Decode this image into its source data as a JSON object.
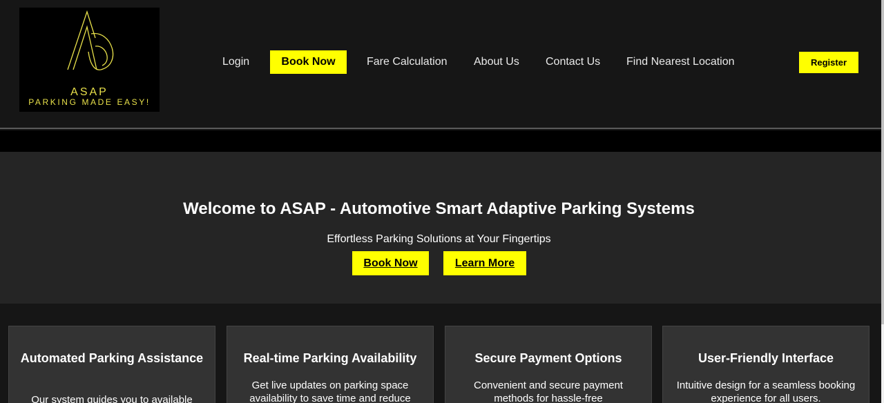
{
  "brand": {
    "name": "ASAP",
    "tagline": "PARKING MADE EASY!",
    "accent_color": "#e8e04a"
  },
  "nav": {
    "login": "Login",
    "book_now": "Book Now",
    "fare_calculation": "Fare Calculation",
    "about_us": "About Us",
    "contact_us": "Contact Us",
    "find_nearest": "Find Nearest Location",
    "register": "Register"
  },
  "hero": {
    "title": "Welcome to ASAP - Automotive Smart Adaptive Parking Systems",
    "subtitle": "Effortless Parking Solutions at Your Fingertips",
    "book_now": "Book Now",
    "learn_more": "Learn More"
  },
  "features": [
    {
      "title": "Automated Parking Assistance",
      "text": "Our system guides you to available"
    },
    {
      "title": "Real-time Parking Availability",
      "text": "Get live updates on parking space availability to save time and reduce"
    },
    {
      "title": "Secure Payment Options",
      "text": "Convenient and secure payment methods for hassle-free"
    },
    {
      "title": "User-Friendly Interface",
      "text": "Intuitive design for a seamless booking experience for all users."
    }
  ],
  "colors": {
    "button_yellow": "#ffff00",
    "background": "#161616",
    "hero_background": "#252525",
    "card_background": "#333333"
  }
}
